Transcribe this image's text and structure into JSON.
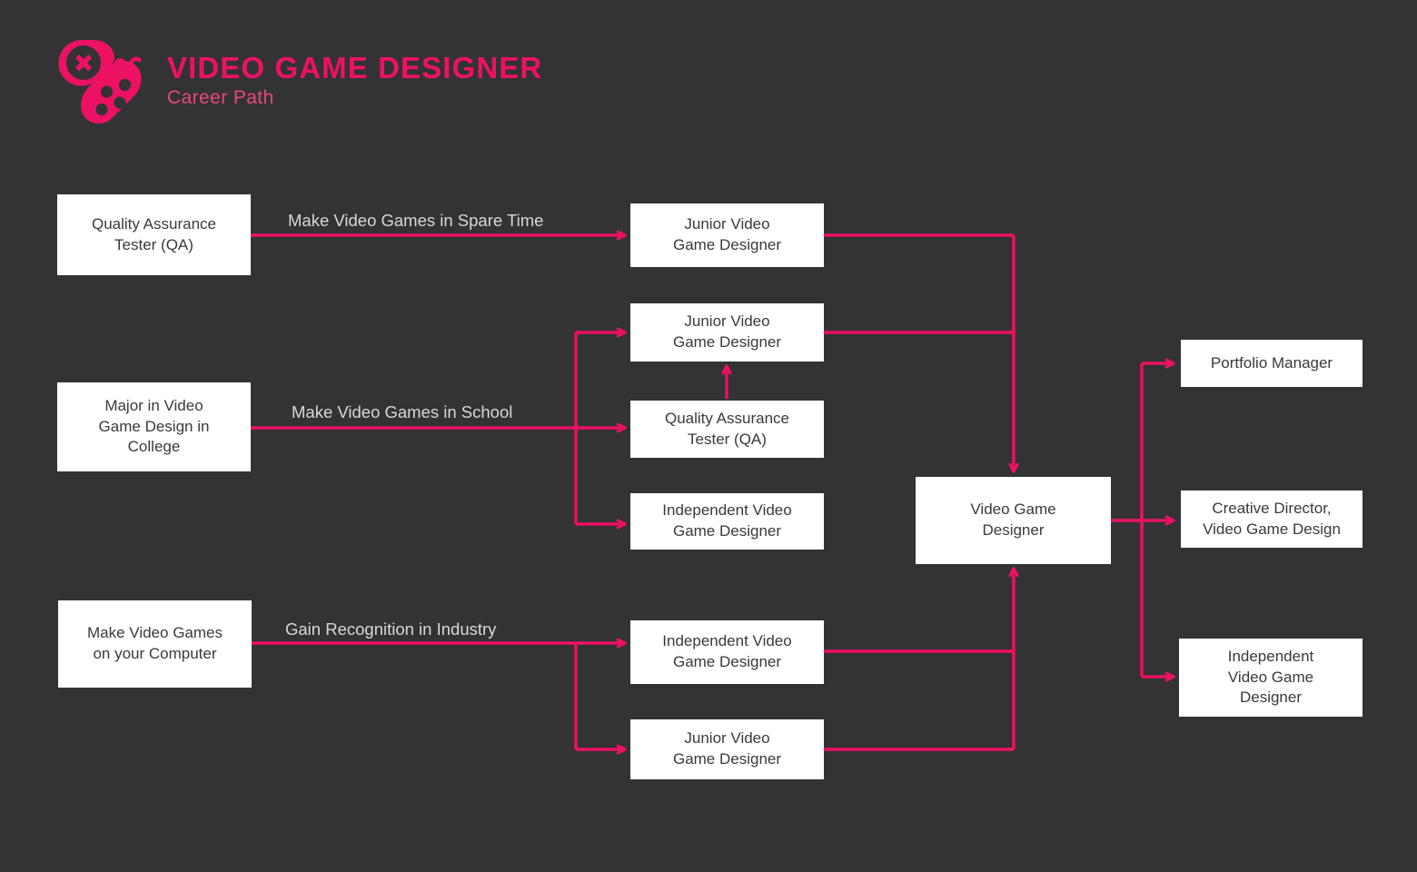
{
  "header": {
    "title": "VIDEO GAME DESIGNER",
    "subtitle": "Career Path",
    "logo_icon": "gamepad-icon"
  },
  "colors": {
    "background": "#333333",
    "accent": "#ED1164",
    "node_fill": "#FFFFFF",
    "node_text": "#3A3A3A",
    "label_text": "#D8D8D8"
  },
  "nodes": {
    "entry_qa_tester": "Quality Assurance\nTester (QA)",
    "entry_major_college": "Major in Video\nGame Design in\nCollege",
    "entry_make_games_computer": "Make Video Games\non your Computer",
    "mid_junior_1": "Junior Video\nGame Designer",
    "mid_junior_2": "Junior Video\nGame Designer",
    "mid_qa_tester": "Quality Assurance\nTester (QA)",
    "mid_independent_1": "Independent Video\nGame Designer",
    "mid_independent_2": "Independent Video\nGame Designer",
    "mid_junior_3": "Junior Video\nGame Designer",
    "center_video_game_designer": "Video Game\nDesigner",
    "out_portfolio_manager": "Portfolio Manager",
    "out_creative_director": "Creative Director,\nVideo Game Design",
    "out_independent": "Independent\nVideo Game\nDesigner"
  },
  "edge_labels": {
    "spare_time": "Make Video Games in Spare Time",
    "in_school": "Make Video Games in School",
    "recognition": "Gain Recognition in Industry"
  },
  "chart_data": {
    "type": "diagram",
    "title": "VIDEO GAME DESIGNER Career Path",
    "flow": [
      {
        "from": "Quality Assurance Tester (QA)",
        "to": "Junior Video Game Designer",
        "label": "Make Video Games in Spare Time"
      },
      {
        "from": "Major in Video Game Design in College",
        "to": "Junior Video Game Designer",
        "label": "Make Video Games in School"
      },
      {
        "from": "Major in Video Game Design in College",
        "to": "Quality Assurance Tester (QA)",
        "label": "Make Video Games in School"
      },
      {
        "from": "Major in Video Game Design in College",
        "to": "Independent Video Game Designer",
        "label": "Make Video Games in School"
      },
      {
        "from": "Quality Assurance Tester (QA)",
        "to": "Junior Video Game Designer",
        "label": ""
      },
      {
        "from": "Make Video Games on your Computer",
        "to": "Independent Video Game Designer",
        "label": "Gain Recognition in Industry"
      },
      {
        "from": "Make Video Games on your Computer",
        "to": "Junior Video Game Designer",
        "label": "Gain Recognition in Industry"
      },
      {
        "from": "Junior Video Game Designer",
        "to": "Video Game Designer",
        "label": ""
      },
      {
        "from": "Independent Video Game Designer",
        "to": "Video Game Designer",
        "label": ""
      },
      {
        "from": "Video Game Designer",
        "to": "Portfolio Manager",
        "label": ""
      },
      {
        "from": "Video Game Designer",
        "to": "Creative Director, Video Game Design",
        "label": ""
      },
      {
        "from": "Video Game Designer",
        "to": "Independent Video Game Designer",
        "label": ""
      }
    ]
  }
}
